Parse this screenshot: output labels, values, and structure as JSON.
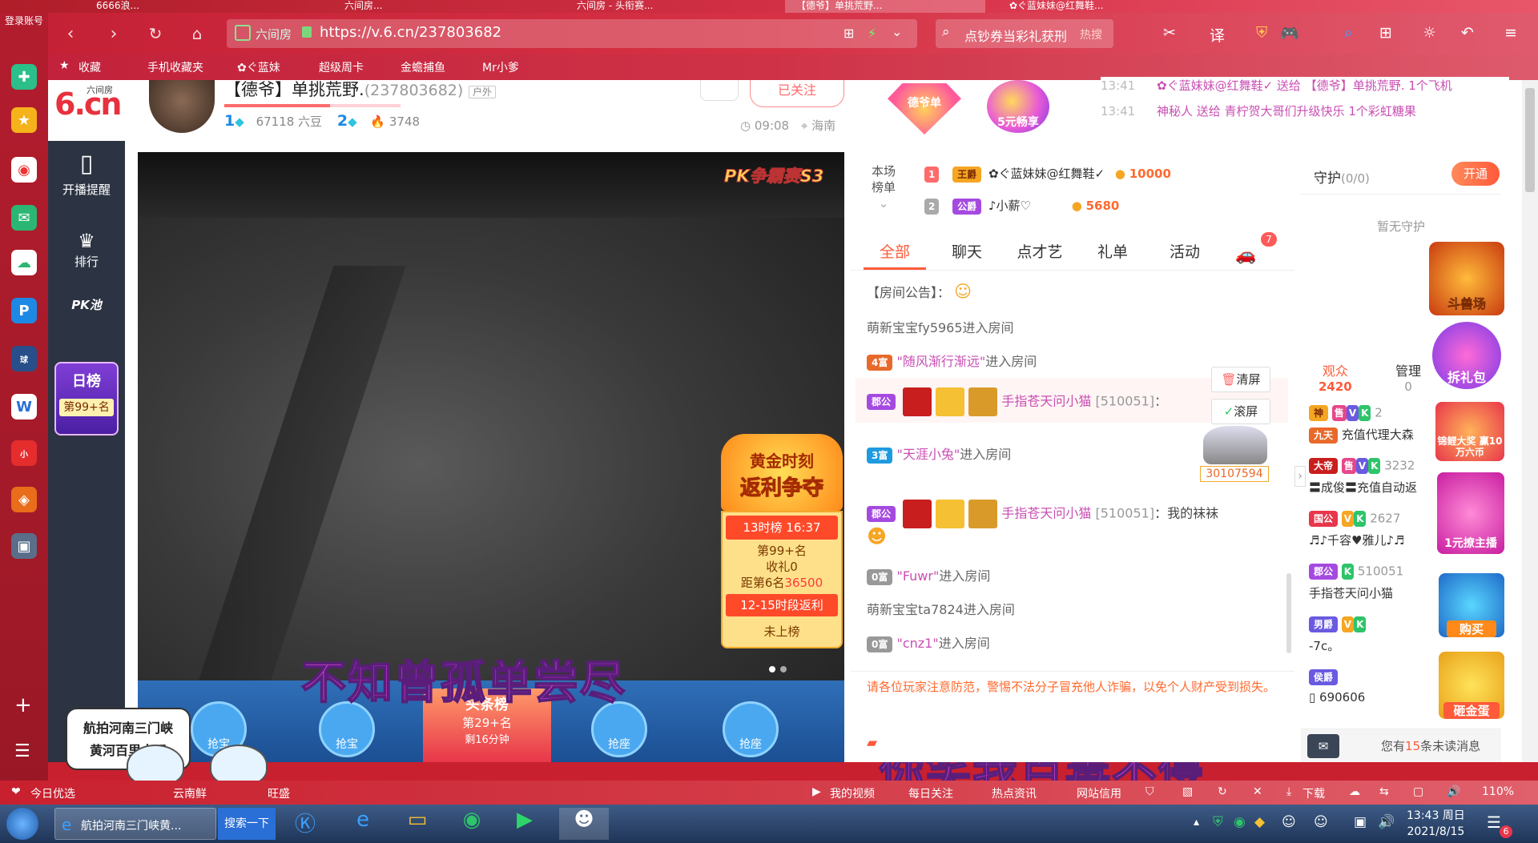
{
  "browser": {
    "tabs": [
      "6666浪...",
      "六间房...",
      "六间房 - 头衔赛...",
      "【德爷】单挑荒野...",
      "✿ぐ蓝妹妹@红舞鞋..."
    ],
    "login_label": "登录账号",
    "url": "https://v.6.cn/237803682",
    "url_site_tag": "六间房",
    "search_text": "点钞券当彩礼获刑",
    "search_hot": "热搜",
    "bookmarks": [
      "收藏",
      "手机收藏夹",
      "✿ぐ蓝妹",
      "超级周卡",
      "金蟾捕鱼",
      "Mr小爹"
    ],
    "zoom": "110%"
  },
  "site": {
    "logo_text": "6.cn",
    "logo_sub": "六间房",
    "nav": [
      "开播提醒",
      "排行",
      "PK池"
    ],
    "day_rank_title": "日榜",
    "day_rank_value": "第99+名"
  },
  "room": {
    "title": "【德爷】单挑荒野.",
    "room_id": "(237803682)",
    "category": "户外",
    "level1": "1",
    "beans": "67118 六豆",
    "level2": "2",
    "heat": "3748",
    "follow_label": "已关注",
    "time": "09:08",
    "location": "海南",
    "badge_de": "德爷单",
    "badge_5yuan": "5元畅享",
    "marquee": [
      {
        "time": "13:41",
        "text": "✿ぐ蓝妹妹@红舞鞋✓ 送给 【德爷】单挑荒野. 1个飞机"
      },
      {
        "time": "13:41",
        "text": "神秘人 送给 青柠贺大哥们升级快乐 1个彩虹糖果"
      }
    ]
  },
  "stage": {
    "pk_banner": "PK争霸赛S3",
    "gold_title": "黄金时刻",
    "gold_sub": "返利争夺",
    "hour_rank": "13时榜 16:37",
    "rank_pos": "第99+名",
    "gift_recv": "收礼0",
    "gap_label": "距第6名",
    "gap_value": "36500",
    "rebate_slot": "12-15时段返利",
    "not_ranked": "未上榜",
    "seat_labels": [
      "抢宝",
      "抢宝",
      "抢座",
      "抢座"
    ],
    "headline_label": "头条榜",
    "headline_rank": "第29+名",
    "headline_time": "剩16分钟",
    "caption1": "不知曾孤单尝尽",
    "caption2": "你笑我百毒不侵",
    "promo_line1": "航拍河南三门峡",
    "promo_line2": "黄河百里大观"
  },
  "rank": {
    "label_line1": "本场",
    "label_line2": "榜单",
    "entries": [
      {
        "pos": "1",
        "title": "王爵",
        "name": "✿ぐ蓝妹妹@红舞鞋✓",
        "score": "10000"
      },
      {
        "pos": "2",
        "title": "公爵",
        "name": "♪小薪♡",
        "score": "5680"
      }
    ]
  },
  "chat": {
    "tabs": [
      "全部",
      "聊天",
      "点才艺",
      "礼单",
      "活动"
    ],
    "car_count": "7",
    "announcement": "【房间公告】：",
    "clear_label": "清屏",
    "scroll_label": "滚屏",
    "car_id": "30107594",
    "lines": [
      {
        "prefix": "",
        "name": "萌新宝宝fy5965",
        "text": "进入房间"
      },
      {
        "prefix": "4富",
        "name": "\"随风渐行渐远\"",
        "text": "进入房间"
      },
      {
        "prefix": "郡公",
        "name": "手指苍天问小猫",
        "id": "[510051]",
        "text": "："
      },
      {
        "prefix": "3富",
        "name": "\"天涯小兔\"",
        "text": "进入房间"
      },
      {
        "prefix": "郡公",
        "name": "手指苍天问小猫",
        "id": "[510051]",
        "text": "：我的袜袜"
      },
      {
        "prefix": "0富",
        "name": "\"Fuwr\"",
        "text": "进入房间"
      },
      {
        "prefix": "",
        "name": "萌新宝宝ta7824",
        "text": "进入房间"
      },
      {
        "prefix": "0富",
        "name": "\"cnz1\"",
        "text": "进入房间"
      }
    ],
    "warning": "请各位玩家注意防范，警惕不法分子冒充他人诈骗，以免个人财产受到损失。"
  },
  "guard": {
    "title": "守护",
    "count": "(0/0)",
    "open_label": "开通",
    "empty": "暂无守护"
  },
  "audience": {
    "tab_viewers": "观众",
    "viewer_count": "2420",
    "tab_admins": "管理",
    "admin_count": "0",
    "users": [
      {
        "title": "神",
        "level": "2",
        "name": "充值代理大森"
      },
      {
        "title": "九天",
        "name": "充值代理大森"
      },
      {
        "title": "大帝",
        "level": "3232",
        "name": "〓成俊〓充值自动返"
      },
      {
        "title": "国公",
        "level": "2627",
        "name": "♬♪千容♥雅儿♪♬"
      },
      {
        "title": "郡公",
        "level": "510051",
        "name": "手指苍天问小猫"
      },
      {
        "title": "男爵",
        "name": "-7c。"
      },
      {
        "title": "侯爵",
        "name": "690606"
      }
    ],
    "unread_prefix": "您有",
    "unread_count": "15",
    "unread_suffix": "条未读消息"
  },
  "promos": [
    "斗兽场",
    "拆礼包",
    "锦鲤大奖 赢10万六币",
    "1元撩主播",
    "购买",
    "砸金蛋"
  ],
  "status": {
    "left": [
      "今日优选",
      "云南鲜",
      "旺盛"
    ],
    "right": [
      "我的视频",
      "每日关注",
      "热点资讯",
      "网站信用",
      "下载"
    ]
  },
  "taskbar": {
    "task1": "航拍河南三门峡黄...",
    "search_btn": "搜索一下",
    "clock_time": "13:43 周日",
    "clock_date": "2021/8/15",
    "notify_count": "6"
  },
  "colors": {
    "brand_red": "#d8243a",
    "accent_orange": "#ff6a2f",
    "link_purple": "#c94fb3",
    "gold": "#f5a623"
  }
}
